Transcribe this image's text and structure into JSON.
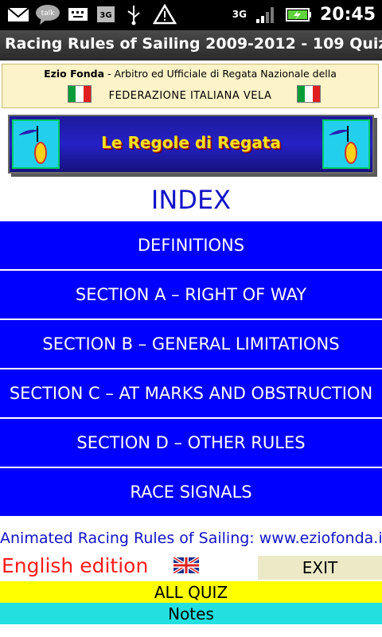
{
  "status_bar": {
    "time": "20:45",
    "network": "3G",
    "talk_label": "talk",
    "icons": [
      "email-icon",
      "talk-icon",
      "keyboard-icon",
      "3g-icon",
      "usb-icon",
      "warning-icon",
      "signal-icon",
      "battery-icon"
    ]
  },
  "app": {
    "title": "Racing Rules of Sailing 2009-2012 - 109 Quiz"
  },
  "header": {
    "author_name": "Ezio Fonda",
    "author_role": " - Arbitro ed Ufficiale di Regata Nazionale della",
    "federation": "FEDERAZIONE ITALIANA VELA",
    "logo_title": "Le Regole di Regata"
  },
  "index": {
    "title": "INDEX",
    "items": [
      {
        "label": "DEFINITIONS"
      },
      {
        "label": "SECTION A – RIGHT OF WAY"
      },
      {
        "label": "SECTION B – GENERAL LIMITATIONS"
      },
      {
        "label": "SECTION C – AT MARKS AND OBSTRUCTION"
      },
      {
        "label": "SECTION D – OTHER RULES"
      },
      {
        "label": "RACE SIGNALS"
      }
    ]
  },
  "footer": {
    "link_text": "Animated Racing Rules of Sailing: www.eziofonda.it",
    "edition": "English edition",
    "exit_label": "EXIT",
    "all_quiz_label": "ALL QUIZ",
    "notes_label": "Notes"
  },
  "colors": {
    "menu_blue": "#0000ff",
    "index_title": "#1212c8",
    "edition_red": "#ff1a1a",
    "all_quiz_yellow": "#ffff00",
    "notes_cyan": "#22e0e0",
    "exit_beige": "#ece9c6"
  }
}
